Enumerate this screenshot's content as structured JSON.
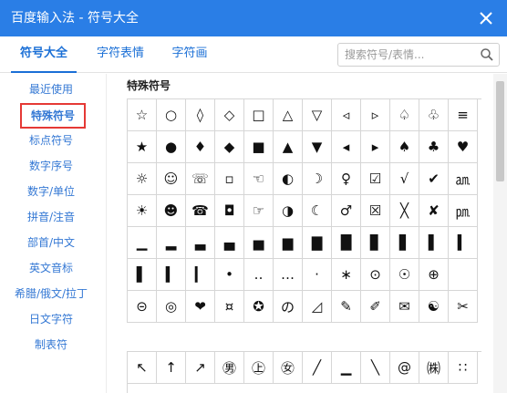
{
  "window": {
    "title": "百度输入法 - 符号大全"
  },
  "tabs": [
    {
      "label": "符号大全"
    },
    {
      "label": "字符表情"
    },
    {
      "label": "字符画"
    }
  ],
  "search": {
    "placeholder": "搜索符号/表情..."
  },
  "sidebar": {
    "items": [
      {
        "label": "最近使用"
      },
      {
        "label": "特殊符号"
      },
      {
        "label": "标点符号"
      },
      {
        "label": "数字序号"
      },
      {
        "label": "数字/单位"
      },
      {
        "label": "拼音/注音"
      },
      {
        "label": "部首/中文"
      },
      {
        "label": "英文音标"
      },
      {
        "label": "希腊/俄文/拉丁"
      },
      {
        "label": "日文字符"
      },
      {
        "label": "制表符"
      }
    ],
    "active_index": 1
  },
  "section": {
    "title": "特殊符号"
  },
  "grid1": [
    [
      "☆",
      "○",
      "◊",
      "◇",
      "□",
      "△",
      "▽",
      "◃",
      "▹",
      "♤",
      "♧",
      "≡"
    ],
    [
      "★",
      "●",
      "♦",
      "◆",
      "■",
      "▲",
      "▼",
      "◂",
      "▸",
      "♠",
      "♣",
      "♥"
    ],
    [
      "☼",
      "☺",
      "☏",
      "▫",
      "☜",
      "◐",
      "☽",
      "♀",
      "☑",
      "√",
      "✔",
      "㏂"
    ],
    [
      "☀",
      "☻",
      "☎",
      "◘",
      "☞",
      "◑",
      "☾",
      "♂",
      "☒",
      "╳",
      "✘",
      "㏘"
    ],
    [
      "▁",
      "▂",
      "▃",
      "▄",
      "▅",
      "▆",
      "▇",
      "█",
      "▊",
      "▋",
      "▌",
      "▍"
    ],
    [
      "▌",
      "▍",
      "▎",
      "•",
      "‥",
      "…",
      "·",
      "∗",
      "⊙",
      "☉",
      "⊕",
      ""
    ],
    [
      "⊝",
      "◎",
      "❤",
      "¤",
      "✪",
      "の",
      "◿",
      "✎",
      "✐",
      "✉",
      "☯",
      "✂"
    ]
  ],
  "grid2": [
    [
      "↖",
      "↑",
      "↗",
      "㊚",
      "㊤",
      "㊛",
      "╱",
      "▁",
      "╲",
      "@",
      "㈱",
      "∷"
    ]
  ],
  "colors": {
    "titlebar": "#2a7ee6",
    "accent": "#1a6fd6",
    "sidebar_text": "#3478d4",
    "active_border": "#e53935"
  },
  "icons": {
    "close": "close-icon",
    "search": "search-icon"
  }
}
